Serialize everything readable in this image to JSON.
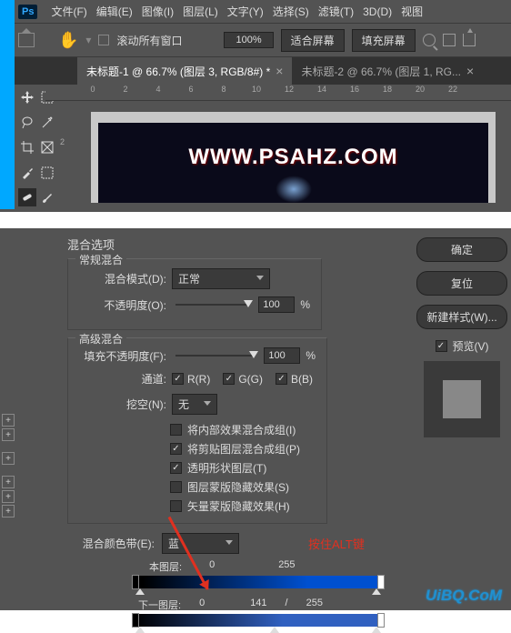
{
  "menubar": {
    "items": [
      "文件(F)",
      "编辑(E)",
      "图像(I)",
      "图层(L)",
      "文字(Y)",
      "选择(S)",
      "滤镜(T)",
      "3D(D)",
      "视图"
    ]
  },
  "optbar": {
    "scroll_all": "滚动所有窗口",
    "zoom": "100%",
    "fit_screen": "适合屏幕",
    "fill_screen": "填充屏幕"
  },
  "tabs": {
    "tab1": "未标题-1 @ 66.7% (图层 3, RGB/8#) *",
    "tab2": "未标题-2 @ 66.7% (图层 1, RG..."
  },
  "ruler": {
    "marks": [
      "0",
      "2",
      "4",
      "6",
      "8",
      "10",
      "12",
      "14",
      "16",
      "18",
      "20",
      "22"
    ],
    "v": "2"
  },
  "watermark": "WWW.PSAHZ.COM",
  "dialog": {
    "title": "混合选项",
    "general": {
      "legend": "常规混合",
      "mode_label": "混合模式(D):",
      "mode_value": "正常",
      "opacity_label": "不透明度(O):",
      "opacity_value": "100",
      "percent": "%"
    },
    "advanced": {
      "legend": "高级混合",
      "fill_label": "填充不透明度(F):",
      "fill_value": "100",
      "percent": "%",
      "channel_label": "通道:",
      "r": "R(R)",
      "g": "G(G)",
      "b": "B(B)",
      "knockout_label": "挖空(N):",
      "knockout_value": "无",
      "chk1": "将内部效果混合成组(I)",
      "chk2": "将剪贴图层混合成组(P)",
      "chk3": "透明形状图层(T)",
      "chk4": "图层蒙版隐藏效果(S)",
      "chk5": "矢量蒙版隐藏效果(H)"
    },
    "blendif": {
      "label": "混合颜色带(E):",
      "value": "蓝",
      "this_label": "本图层:",
      "this_lo": "0",
      "this_hi": "255",
      "under_label": "下一图层:",
      "under_lo": "0",
      "under_mid": "141",
      "slash": "/",
      "under_hi": "255",
      "hint": "按住ALT键"
    },
    "buttons": {
      "ok": "确定",
      "reset": "复位",
      "new_style": "新建样式(W)...",
      "preview": "预览(V)"
    }
  },
  "footer_brand": "UiBQ.CoM"
}
